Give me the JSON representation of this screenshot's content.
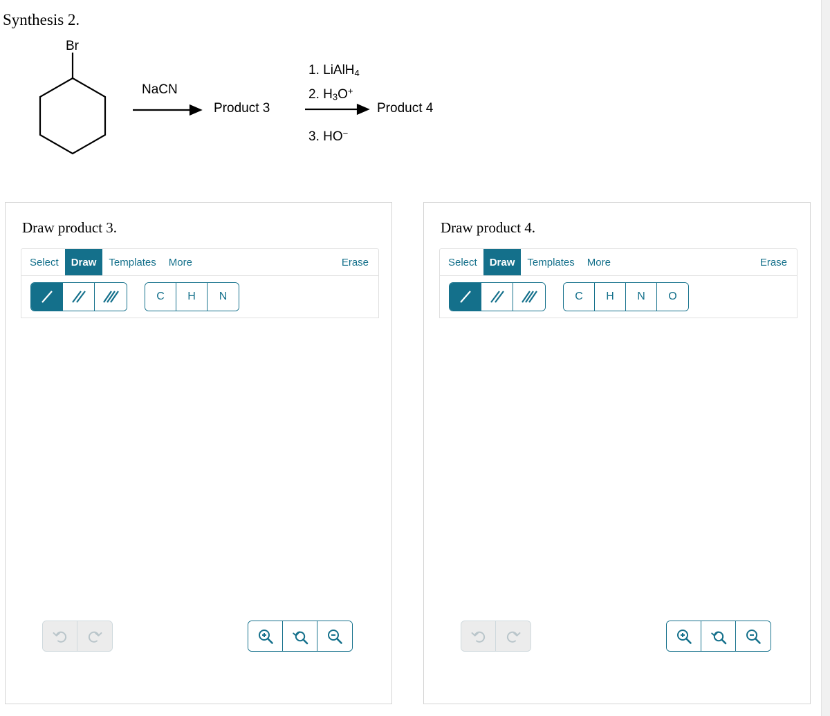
{
  "scheme": {
    "title": "Synthesis 2.",
    "substituent_label": "Br",
    "reagent_step1": "NaCN",
    "intermediate_label": "Product 3",
    "reagents_step2": [
      {
        "index": "1.",
        "formula_html": "LiAlH",
        "sub": "4",
        "sup": ""
      },
      {
        "index": "2.",
        "formula_html": "H",
        "sub": "3",
        "sup": ""
      },
      {
        "index": "3.",
        "formula_html": "HO",
        "sub": "",
        "sup": ""
      }
    ],
    "reagent_line_1": "1. LiAlH4",
    "reagent_line_2": "2. H3O+",
    "reagent_line_3": "3. HO-",
    "final_label": "Product 4"
  },
  "colors": {
    "accent_teal": "#14708b",
    "card_border": "#d3d3d3",
    "disabled_grey": "#ececec",
    "disabled_icon": "#b9c5ca"
  },
  "panels": [
    {
      "id": "left",
      "title": "Draw product 3.",
      "tabs": [
        {
          "label": "Select",
          "active": false
        },
        {
          "label": "Draw",
          "active": true
        },
        {
          "label": "Templates",
          "active": false
        },
        {
          "label": "More",
          "active": false
        }
      ],
      "erase_label": "Erase",
      "bond_tools": [
        {
          "name": "single-bond",
          "selected": true
        },
        {
          "name": "double-bond",
          "selected": false
        },
        {
          "name": "triple-bond",
          "selected": false
        }
      ],
      "element_buttons": [
        "C",
        "H",
        "N"
      ],
      "history_buttons": [
        {
          "name": "undo",
          "enabled": false
        },
        {
          "name": "redo",
          "enabled": false
        }
      ],
      "zoom_buttons": [
        {
          "name": "zoom-in",
          "enabled": true
        },
        {
          "name": "zoom-reset",
          "enabled": true
        },
        {
          "name": "zoom-out",
          "enabled": true
        }
      ],
      "canvas_content": ""
    },
    {
      "id": "right",
      "title": "Draw product 4.",
      "tabs": [
        {
          "label": "Select",
          "active": false
        },
        {
          "label": "Draw",
          "active": true
        },
        {
          "label": "Templates",
          "active": false
        },
        {
          "label": "More",
          "active": false
        }
      ],
      "erase_label": "Erase",
      "bond_tools": [
        {
          "name": "single-bond",
          "selected": true
        },
        {
          "name": "double-bond",
          "selected": false
        },
        {
          "name": "triple-bond",
          "selected": false
        }
      ],
      "element_buttons": [
        "C",
        "H",
        "N",
        "O"
      ],
      "history_buttons": [
        {
          "name": "undo",
          "enabled": false
        },
        {
          "name": "redo",
          "enabled": false
        }
      ],
      "zoom_buttons": [
        {
          "name": "zoom-in",
          "enabled": true
        },
        {
          "name": "zoom-reset",
          "enabled": true
        },
        {
          "name": "zoom-out",
          "enabled": true
        }
      ],
      "canvas_content": ""
    }
  ]
}
